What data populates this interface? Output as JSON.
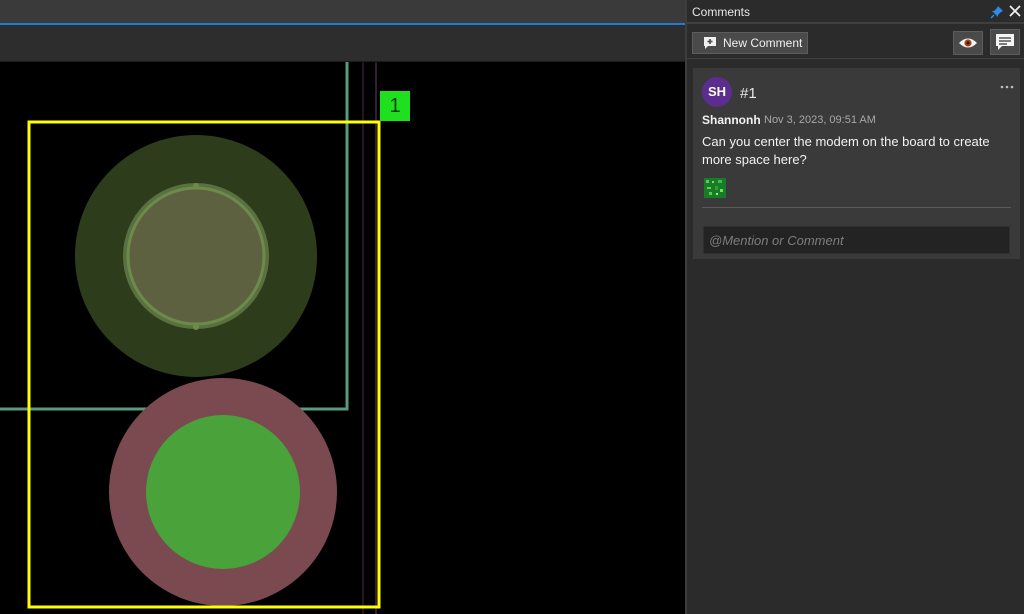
{
  "panel": {
    "title": "Comments",
    "new_comment_label": "New Comment",
    "icons": {
      "pin": "pin-icon",
      "close": "close-icon",
      "new_comment": "comment-plus-icon",
      "visibility": "eye-icon",
      "comments_list": "chat-bubble-icon",
      "more": "more-horizontal-icon"
    }
  },
  "comment": {
    "avatar_initials": "SH",
    "number": "#1",
    "author": "Shannonh",
    "timestamp": "Nov 3, 2023, 09:51 AM",
    "text": "Can you center the modem on the board to create more space here?",
    "reply_placeholder": "@Mention or Comment"
  },
  "canvas": {
    "marker_label": "1"
  },
  "colors": {
    "accent": "#1c7bd6",
    "avatar": "#5b2d8e",
    "selection": "#ffff00",
    "marker": "#1fe01f",
    "pad_outer_top": "#2d3d1c",
    "pad_outer_bottom": "#7a4a50",
    "pad_inner_bottom": "#4aa23a"
  }
}
